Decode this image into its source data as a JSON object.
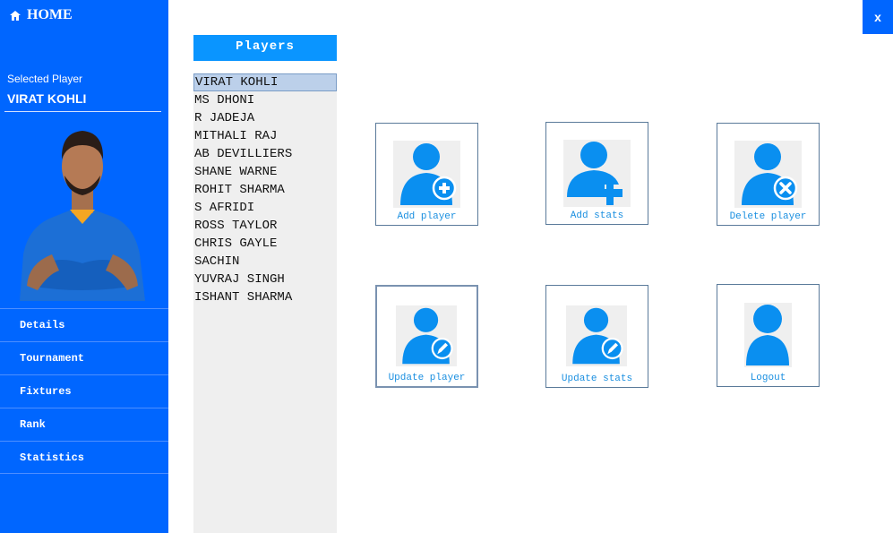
{
  "header": {
    "home_label": "HOME",
    "close_label": "x"
  },
  "selected": {
    "label": "Selected Player",
    "name": "VIRAT KOHLI"
  },
  "nav": [
    "Details",
    "Tournament",
    "Fixtures",
    "Rank",
    "Statistics"
  ],
  "players_panel": {
    "title": "Players",
    "items": [
      "VIRAT KOHLI",
      "MS DHONI",
      "R JADEJA",
      "MITHALI RAJ",
      "AB DEVILLIERS",
      "SHANE WARNE",
      "ROHIT SHARMA",
      "S AFRIDI",
      "ROSS TAYLOR",
      "CHRIS GAYLE",
      "SACHIN",
      "YUVRAJ SINGH",
      "ISHANT SHARMA"
    ]
  },
  "actions": [
    {
      "label": "Add player",
      "icon": "user-add-icon"
    },
    {
      "label": "Add stats",
      "icon": "user-plus-stats-icon"
    },
    {
      "label": "Delete player",
      "icon": "user-delete-icon"
    },
    {
      "label": "Update player",
      "icon": "user-edit-icon"
    },
    {
      "label": "Update stats",
      "icon": "user-edit-stats-icon"
    },
    {
      "label": "Logout",
      "icon": "user-logout-icon"
    }
  ],
  "colors": {
    "sidebar": "#0066ff",
    "accent": "#0a95ff",
    "icon": "#0a8ff0"
  }
}
